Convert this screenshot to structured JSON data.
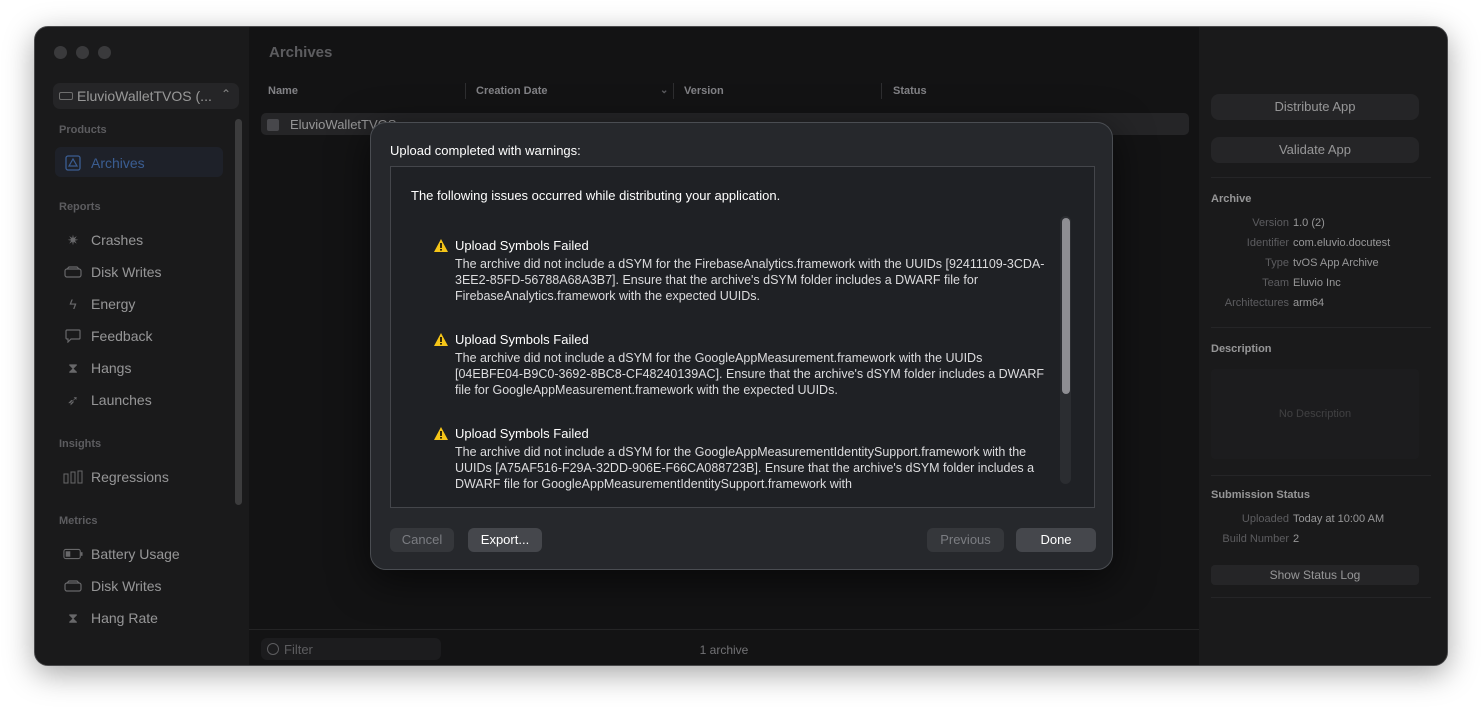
{
  "sidebar": {
    "scheme": "EluvioWalletTVOS (...",
    "sections": {
      "products": "Products",
      "reports": "Reports",
      "insights": "Insights",
      "metrics": "Metrics"
    },
    "products_items": [
      "Archives"
    ],
    "reports_items": [
      "Crashes",
      "Disk Writes",
      "Energy",
      "Feedback",
      "Hangs",
      "Launches"
    ],
    "insights_items": [
      "Regressions"
    ],
    "metrics_items": [
      "Battery Usage",
      "Disk Writes",
      "Hang Rate"
    ]
  },
  "main": {
    "title": "Archives",
    "columns": [
      "Name",
      "Creation Date",
      "Version",
      "Status"
    ],
    "row": {
      "name": "EluvioWalletTVOS"
    },
    "filter_placeholder": "Filter",
    "count": "1 archive"
  },
  "inspector": {
    "distribute": "Distribute App",
    "validate": "Validate App",
    "archive_heading": "Archive",
    "archive_fields": [
      {
        "k": "Version",
        "v": "1.0 (2)"
      },
      {
        "k": "Identifier",
        "v": "com.eluvio.docutest"
      },
      {
        "k": "Type",
        "v": "tvOS App Archive"
      },
      {
        "k": "Team",
        "v": "Eluvio Inc"
      },
      {
        "k": "Architectures",
        "v": "arm64"
      }
    ],
    "description_heading": "Description",
    "description_placeholder": "No Description",
    "submission_heading": "Submission Status",
    "submission_fields": [
      {
        "k": "Uploaded",
        "v": "Today at 10:00 AM"
      },
      {
        "k": "Build Number",
        "v": "2"
      }
    ],
    "status_log": "Show Status Log"
  },
  "sheet": {
    "title": "Upload completed with warnings:",
    "intro": "The following issues occurred while distributing your application.",
    "issues": [
      {
        "title": "Upload Symbols Failed",
        "body": "The archive did not include a dSYM for the FirebaseAnalytics.framework with the UUIDs [92411109-3CDA-3EE2-85FD-56788A68A3B7]. Ensure that the archive's dSYM folder includes a DWARF file for FirebaseAnalytics.framework with the expected UUIDs."
      },
      {
        "title": "Upload Symbols Failed",
        "body": "The archive did not include a dSYM for the GoogleAppMeasurement.framework with the UUIDs [04EBFE04-B9C0-3692-8BC8-CF48240139AC]. Ensure that the archive's dSYM folder includes a DWARF file for GoogleAppMeasurement.framework with the expected UUIDs."
      },
      {
        "title": "Upload Symbols Failed",
        "body": "The archive did not include a dSYM for the GoogleAppMeasurementIdentitySupport.framework with the UUIDs [A75AF516-F29A-32DD-906E-F66CA088723B]. Ensure that the archive's dSYM folder includes a DWARF file for GoogleAppMeasurementIdentitySupport.framework with"
      }
    ],
    "buttons": {
      "cancel": "Cancel",
      "export": "Export...",
      "previous": "Previous",
      "done": "Done"
    }
  }
}
